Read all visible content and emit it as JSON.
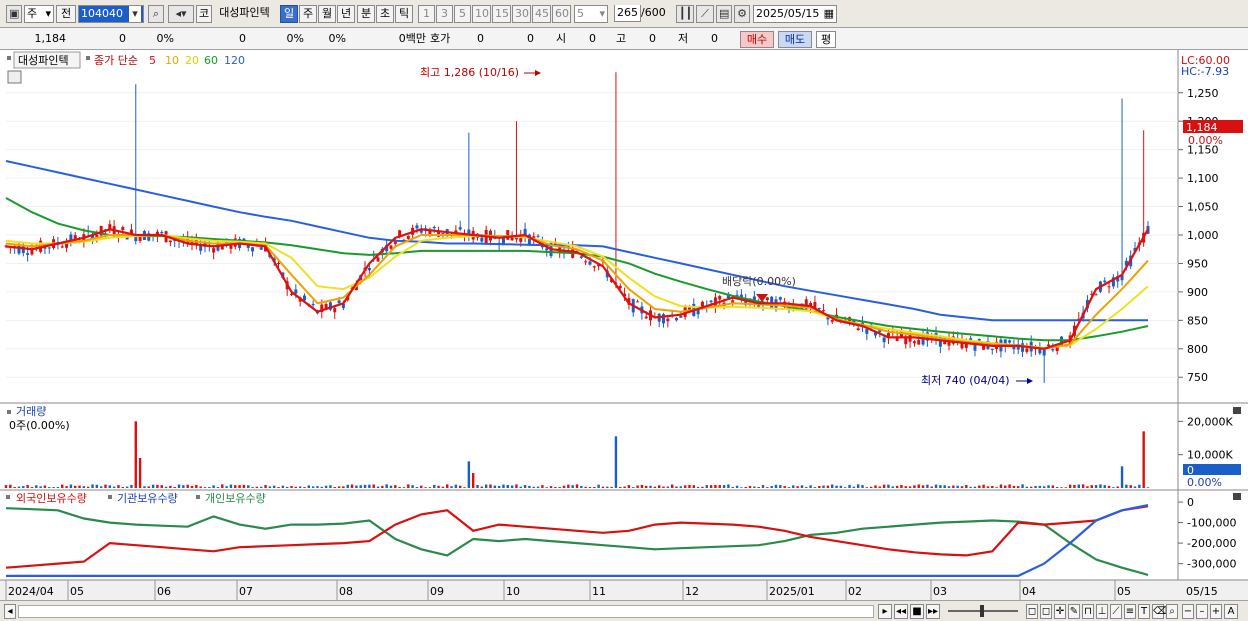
{
  "toolbar": {
    "type_select": "주",
    "prev_label": "전",
    "code": "104040",
    "market_badge": "코",
    "stock_name": "대성파인텍",
    "periods": [
      "일",
      "주",
      "월",
      "년",
      "분",
      "초",
      "틱"
    ],
    "active_period": "일",
    "minute_units": [
      "1",
      "3",
      "5",
      "10",
      "15",
      "30",
      "45",
      "60"
    ],
    "custom_unit": "5",
    "count": "265",
    "count_max": "/600",
    "date": "2025/05/15"
  },
  "quote": {
    "price": "1,184",
    "change": "0",
    "change_pct": "0%",
    "volume": "0",
    "vol_pct": "0%",
    "pct3": "0%",
    "amount": "0백만",
    "hoga_label": "호가",
    "hoga1": "0",
    "hoga2": "0",
    "open_label": "시",
    "open": "0",
    "high_label": "고",
    "high": "0",
    "low_label": "저",
    "low": "0",
    "buy_label": "매수",
    "sell_label": "매도",
    "eval_label": "평"
  },
  "legend": {
    "stock": "대성파인텍",
    "ma_label": "종가 단순",
    "ma_periods": [
      "5",
      "10",
      "20",
      "60",
      "120"
    ]
  },
  "chart_data": [
    {
      "type": "candlestick",
      "price_ticks": [
        750,
        800,
        850,
        900,
        950,
        1000,
        1050,
        1100,
        1150,
        1200,
        1250
      ],
      "ylim": [
        710,
        1290
      ],
      "high_annotation": "최고 1,286 (10/16)",
      "low_annotation": "최저 740 (04/04)",
      "dividend_annotation": "배당락(0.00%)",
      "lc_label": "LC:60.00",
      "hc_label": "HC:-7.93",
      "last_price_label": "1,184",
      "last_pct_label": "0.00%",
      "x_labels": [
        "2024/04",
        "05",
        "06",
        "07",
        "08",
        "09",
        "10",
        "11",
        "12",
        "2025/01",
        "02",
        "03",
        "04",
        "05"
      ],
      "x_right_label": "05/15",
      "ma_colors": {
        "5": "#e01010",
        "10": "#f0a000",
        "20": "#f0e020",
        "60": "#1a9a2a",
        "120": "#2a5ee0"
      },
      "series": [
        {
          "name": "5",
          "values": [
            980,
            975,
            985,
            995,
            1010,
            1000,
            1000,
            985,
            980,
            985,
            980,
            900,
            865,
            880,
            950,
            995,
            1010,
            1005,
            1000,
            995,
            1000,
            975,
            970,
            945,
            880,
            855,
            860,
            875,
            890,
            880,
            880,
            875,
            850,
            840,
            820,
            820,
            815,
            810,
            805,
            805,
            800,
            815,
            905,
            930,
            1010
          ]
        },
        {
          "name": "10",
          "values": [
            985,
            980,
            985,
            990,
            1000,
            1000,
            1000,
            990,
            985,
            985,
            982,
            930,
            880,
            890,
            930,
            980,
            1000,
            1000,
            1000,
            998,
            998,
            982,
            975,
            955,
            905,
            870,
            865,
            872,
            880,
            878,
            876,
            872,
            852,
            842,
            830,
            825,
            818,
            812,
            808,
            806,
            800,
            808,
            860,
            905,
            955
          ]
        },
        {
          "name": "20",
          "values": [
            990,
            985,
            985,
            988,
            995,
            998,
            1000,
            994,
            990,
            988,
            985,
            960,
            910,
            905,
            925,
            962,
            990,
            995,
            998,
            998,
            996,
            988,
            980,
            962,
            925,
            892,
            875,
            872,
            874,
            872,
            870,
            866,
            852,
            842,
            835,
            828,
            822,
            815,
            810,
            806,
            802,
            806,
            835,
            870,
            910
          ]
        },
        {
          "name": "60",
          "values": [
            1065,
            1040,
            1020,
            1008,
            1000,
            998,
            998,
            996,
            993,
            990,
            987,
            982,
            975,
            968,
            965,
            968,
            972,
            972,
            972,
            972,
            972,
            970,
            968,
            962,
            950,
            932,
            918,
            905,
            893,
            883,
            875,
            866,
            856,
            848,
            840,
            835,
            830,
            826,
            822,
            818,
            815,
            815,
            822,
            830,
            840
          ]
        },
        {
          "name": "120",
          "values": [
            1130,
            1120,
            1110,
            1100,
            1090,
            1080,
            1070,
            1060,
            1050,
            1040,
            1032,
            1025,
            1015,
            1005,
            995,
            990,
            988,
            985,
            985,
            984,
            983,
            982,
            982,
            980,
            970,
            960,
            950,
            940,
            930,
            920,
            910,
            902,
            894,
            886,
            878,
            870,
            860,
            855,
            850,
            850,
            850,
            850,
            850,
            850,
            850
          ]
        }
      ]
    },
    {
      "type": "bar",
      "title": "거래량",
      "sub_label": "0주(0.00%)",
      "y_ticks": [
        "20,000K",
        "10,000K"
      ],
      "right_current": "0",
      "right_pct": "0.00%",
      "ylim": [
        0,
        21000
      ]
    },
    {
      "type": "line",
      "series": [
        {
          "name": "외국인보유수량",
          "values": [
            -320000,
            -310000,
            -300000,
            -290000,
            -200000,
            -210000,
            -220000,
            -230000,
            -240000,
            -220000,
            -215000,
            -210000,
            -205000,
            -200000,
            -190000,
            -110000,
            -60000,
            -40000,
            -140000,
            -110000,
            -120000,
            -130000,
            -140000,
            -150000,
            -140000,
            -110000,
            -100000,
            -105000,
            -110000,
            -120000,
            -140000,
            -170000,
            -190000,
            -210000,
            -230000,
            -245000,
            -255000,
            -260000,
            -240000,
            -100000,
            -110000,
            -100000,
            -90000,
            -40000,
            -20000
          ]
        },
        {
          "name": "기관보유수량",
          "values": [
            -360000,
            -360000,
            -360000,
            -360000,
            -360000,
            -360000,
            -360000,
            -360000,
            -360000,
            -360000,
            -360000,
            -360000,
            -360000,
            -360000,
            -360000,
            -360000,
            -360000,
            -360000,
            -360000,
            -360000,
            -360000,
            -360000,
            -360000,
            -360000,
            -360000,
            -360000,
            -360000,
            -360000,
            -360000,
            -360000,
            -360000,
            -360000,
            -360000,
            -360000,
            -360000,
            -360000,
            -360000,
            -360000,
            -360000,
            -360000,
            -300000,
            -200000,
            -90000,
            -40000,
            -15000
          ]
        },
        {
          "name": "개인보유수량",
          "values": [
            -30000,
            -35000,
            -40000,
            -80000,
            -100000,
            -110000,
            -115000,
            -120000,
            -70000,
            -110000,
            -130000,
            -110000,
            -110000,
            -105000,
            -90000,
            -180000,
            -230000,
            -260000,
            -180000,
            -190000,
            -180000,
            -190000,
            -200000,
            -210000,
            -220000,
            -230000,
            -225000,
            -220000,
            -215000,
            -210000,
            -190000,
            -160000,
            -150000,
            -130000,
            -120000,
            -110000,
            -100000,
            -95000,
            -90000,
            -95000,
            -110000,
            -200000,
            -280000,
            -320000,
            -355000
          ]
        }
      ],
      "series_colors": [
        "#d81010",
        "#2a5ee0",
        "#2a8a4a"
      ],
      "y_ticks": [
        "0",
        "-100,000",
        "-200,000",
        "-300,000"
      ],
      "ylim": [
        -370000,
        10000
      ]
    }
  ]
}
